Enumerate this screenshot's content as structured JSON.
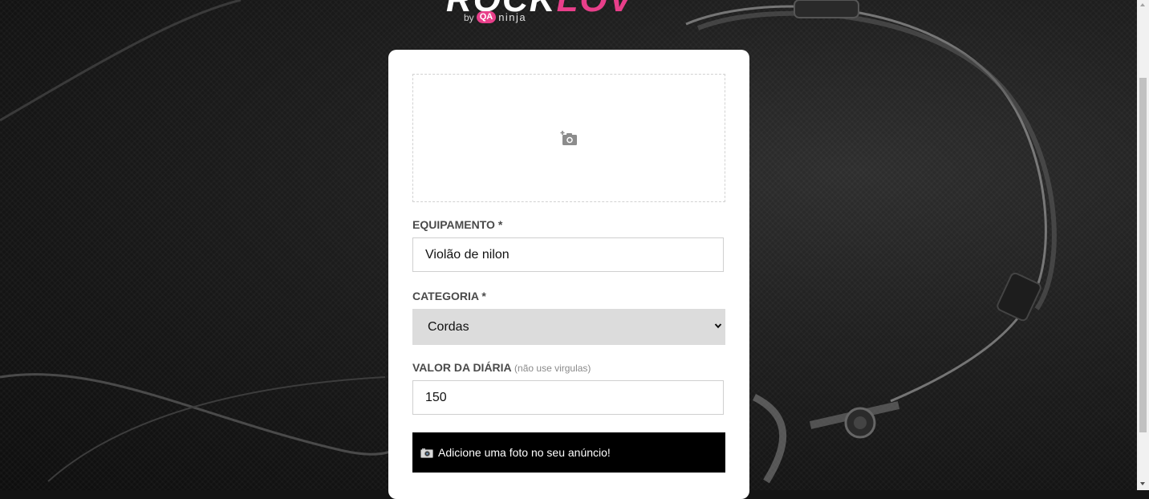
{
  "logo": {
    "word_part1": "ROCK",
    "word_part2": "LOV",
    "by": "by",
    "qa": "QA",
    "ninja": "ninja"
  },
  "form": {
    "dropzone_icon": "add-photo-icon",
    "equipment": {
      "label": "EQUIPAMENTO *",
      "value": "Violão de nilon"
    },
    "category": {
      "label": "CATEGORIA *",
      "selected": "Cordas"
    },
    "daily_price": {
      "label": "VALOR DA DIÁRIA",
      "hint": "(não use virgulas)",
      "value": "150"
    },
    "alert": {
      "icon": "camera-emoji",
      "text": "Adicione uma foto no seu anúncio!"
    }
  },
  "colors": {
    "brand_pink": "#e83f8a",
    "card_bg": "#ffffff",
    "select_bg": "#dcdcdc",
    "alert_bg": "#000000"
  }
}
